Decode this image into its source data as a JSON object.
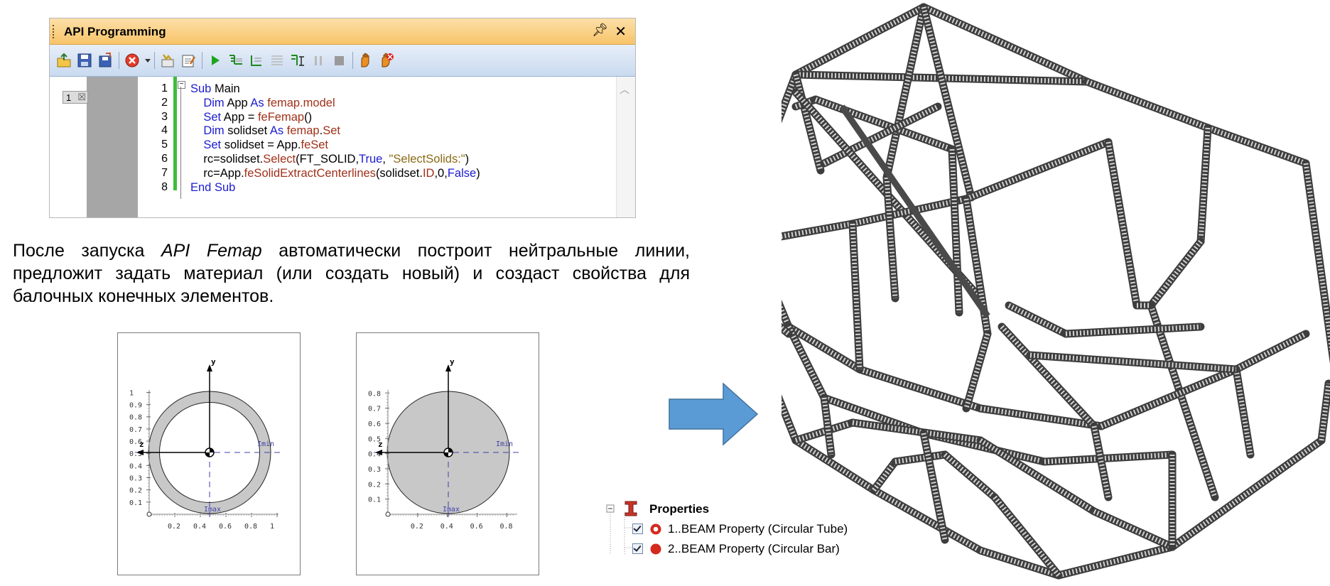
{
  "api_panel": {
    "title": "API Programming",
    "pin_icon": "pin-icon",
    "close_icon": "close-icon",
    "toolbar_icons": [
      "open-icon",
      "save-icon",
      "save-as-icon",
      "delete-icon",
      "dropdown-icon",
      "references-icon",
      "edit-icon",
      "run-icon",
      "step-into-icon",
      "step-over-icon",
      "step-out-icon",
      "step-to-cursor-icon",
      "pause-icon",
      "stop-icon",
      "breakpoint-icon",
      "clear-breakpoint-icon"
    ],
    "doc_tab": "1",
    "line_numbers": [
      "1",
      "2",
      "3",
      "4",
      "5",
      "6",
      "7",
      "8"
    ],
    "code_lines": [
      [
        {
          "t": "Sub",
          "c": "kw"
        },
        {
          "t": " Main",
          "c": ""
        }
      ],
      [
        {
          "t": "    Dim",
          "c": "kw"
        },
        {
          "t": " App ",
          "c": ""
        },
        {
          "t": "As",
          "c": "kw"
        },
        {
          "t": " femap.model",
          "c": "mem"
        }
      ],
      [
        {
          "t": "    Set",
          "c": "kw"
        },
        {
          "t": " App = ",
          "c": ""
        },
        {
          "t": "feFemap",
          "c": "mem"
        },
        {
          "t": "()",
          "c": ""
        }
      ],
      [
        {
          "t": "    Dim",
          "c": "kw"
        },
        {
          "t": " solidset ",
          "c": ""
        },
        {
          "t": "As",
          "c": "kw"
        },
        {
          "t": " femap",
          "c": "mem"
        },
        {
          "t": ".",
          "c": ""
        },
        {
          "t": "Set",
          "c": "mem"
        }
      ],
      [
        {
          "t": "    Set",
          "c": "kw"
        },
        {
          "t": " solidset = App.",
          "c": ""
        },
        {
          "t": "feSet",
          "c": "mem"
        }
      ],
      [
        {
          "t": "    rc=solidset.",
          "c": ""
        },
        {
          "t": "Select",
          "c": "mem"
        },
        {
          "t": "(FT_SOLID,",
          "c": ""
        },
        {
          "t": "True",
          "c": "kw"
        },
        {
          "t": ", ",
          "c": ""
        },
        {
          "t": "\"SelectSolids:\"",
          "c": "str"
        },
        {
          "t": ")",
          "c": ""
        }
      ],
      [
        {
          "t": "    rc=App.",
          "c": ""
        },
        {
          "t": "feSolidExtractCenterlines",
          "c": "mem"
        },
        {
          "t": "(solidset.",
          "c": ""
        },
        {
          "t": "ID",
          "c": "mem"
        },
        {
          "t": ",0,",
          "c": ""
        },
        {
          "t": "False",
          "c": "kw"
        },
        {
          "t": ")",
          "c": ""
        }
      ],
      [
        {
          "t": "End Sub",
          "c": "kw"
        }
      ]
    ]
  },
  "paragraph": {
    "before": "После запуска ",
    "emph": "API Femap",
    "after": " автоматически построит нейтральные линии, предложит задать материал (или создать новый) и создаст свойства для балочных конечных элементов."
  },
  "sections": [
    {
      "kind": "tube",
      "ylabel": "y",
      "zlabel": "z",
      "imax": "Imax",
      "imin": "Imin",
      "yticks": [
        "1",
        "0.9",
        "0.8",
        "0.7",
        "0.6",
        "0.5",
        "0.4",
        "0.3",
        "0.2",
        "0.1"
      ],
      "xticks": [
        "0.2",
        "0.4",
        "0.6",
        "0.8",
        "1"
      ]
    },
    {
      "kind": "bar",
      "ylabel": "y",
      "zlabel": "z",
      "imax": "Imax",
      "imin": "Imin",
      "yticks": [
        "0.8",
        "0.7",
        "0.6",
        "0.5",
        "0.4",
        "0.3",
        "0.2",
        "0.1"
      ],
      "xticks": [
        "0.2",
        "0.4",
        "0.6",
        "0.8"
      ]
    }
  ],
  "properties_tree": {
    "root_label": "Properties",
    "items": [
      {
        "label": "1..BEAM Property (Circular Tube)",
        "icon": "circular-tube-icon",
        "checked": true
      },
      {
        "label": "2..BEAM Property (Circular Bar)",
        "icon": "circular-bar-icon",
        "checked": true
      }
    ]
  },
  "colors": {
    "arrow": "#5b9bd5",
    "titlebar": "#f7c46a",
    "keyword": "#1c1cd0",
    "member": "#a0301a",
    "section_fill": "#c8c8c8"
  }
}
